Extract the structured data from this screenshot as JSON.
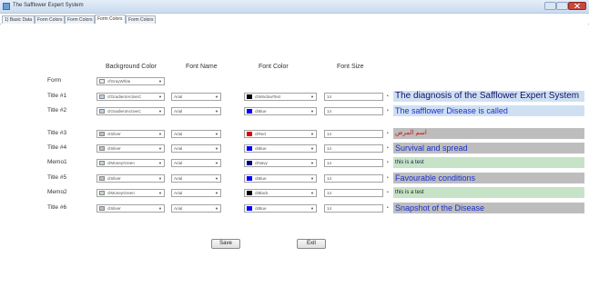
{
  "window": {
    "title": "The Safflower Expert System"
  },
  "tabs": [
    "1) Basic Data",
    "Form Colors",
    "Form Colors",
    "Form Colors",
    "Form Colors"
  ],
  "columns": {
    "background": "Background Color",
    "font_name": "Font Name",
    "font_color": "Font Color",
    "font_size": "Font Size"
  },
  "rows": [
    {
      "label": "Form",
      "bg_text": "cfGrayWhite",
      "bg_color": "#e8eef4",
      "font_name": "",
      "font_color_text": "",
      "font_color_swatch": "",
      "font_size": "",
      "preview": "",
      "preview_bg": "",
      "preview_color": "",
      "preview_size": "",
      "preview_bold": false
    },
    {
      "label": "Title #1",
      "bg_text": "cfGradientActiveC",
      "bg_color": "#b9d1ea",
      "font_name": "Arial",
      "font_color_text": "clWindowText",
      "font_color_swatch": "#000000",
      "font_size": "14",
      "preview": "The diagnosis of the Safflower Expert System",
      "preview_bg": "#cfe0f3",
      "preview_color": "#10106a",
      "preview_size": "10px",
      "preview_bold": false
    },
    {
      "label": "Title #2",
      "bg_text": "clGradientActiveC",
      "bg_color": "#b9d1ea",
      "font_name": "Arial",
      "font_color_text": "clBlue",
      "font_color_swatch": "#0000ff",
      "font_size": "14",
      "preview": "The safflower Disease is called",
      "preview_bg": "#cfe0f3",
      "preview_color": "#1a2fcf",
      "preview_size": "9px",
      "preview_bold": false
    },
    {
      "label": "Title #3",
      "bg_text": "clSilver",
      "bg_color": "#c0c0c0",
      "font_name": "Arial",
      "font_color_text": "clRed",
      "font_color_swatch": "#e00000",
      "font_size": "14",
      "preview": "اسم المرض",
      "preview_bg": "#bdbdbd",
      "preview_color": "#d01010",
      "preview_size": "7px",
      "preview_bold": false
    },
    {
      "label": "Title #4",
      "bg_text": "clSilver",
      "bg_color": "#c0c0c0",
      "font_name": "Arial",
      "font_color_text": "clBlue",
      "font_color_swatch": "#0000ff",
      "font_size": "14",
      "preview": "Survival and spread",
      "preview_bg": "#bdbdbd",
      "preview_color": "#1a2fcf",
      "preview_size": "9px",
      "preview_bold": false
    },
    {
      "label": "Memo1",
      "bg_text": "clMoneyGreen",
      "bg_color": "#c0dcc0",
      "font_name": "Arial",
      "font_color_text": "clNavy",
      "font_color_swatch": "#000080",
      "font_size": "14",
      "preview": "this is a test",
      "preview_bg": "#c7e3c7",
      "preview_color": "#102050",
      "preview_size": "6px",
      "preview_bold": false
    },
    {
      "label": "Title #5",
      "bg_text": "clSilver",
      "bg_color": "#c0c0c0",
      "font_name": "Arial",
      "font_color_text": "clBlue",
      "font_color_swatch": "#0000ff",
      "font_size": "14",
      "preview": "Favourable conditions",
      "preview_bg": "#bdbdbd",
      "preview_color": "#1a2fcf",
      "preview_size": "9px",
      "preview_bold": false
    },
    {
      "label": "Memo2",
      "bg_text": "clMoneyGreen",
      "bg_color": "#c0dcc0",
      "font_name": "Arial",
      "font_color_text": "clBlack",
      "font_color_swatch": "#000000",
      "font_size": "14",
      "preview": "this is a test",
      "preview_bg": "#c7e3c7",
      "preview_color": "#202020",
      "preview_size": "6px",
      "preview_bold": false
    },
    {
      "label": "Title #6",
      "bg_text": "clSilver",
      "bg_color": "#c0c0c0",
      "font_name": "Arial",
      "font_color_text": "clBlue",
      "font_color_swatch": "#0000ff",
      "font_size": "14",
      "preview": "Snapshot of the Disease",
      "preview_bg": "#bdbdbd",
      "preview_color": "#1a2fcf",
      "preview_size": "9px",
      "preview_bold": false
    }
  ],
  "buttons": {
    "save": "Save",
    "exit": "Exit"
  },
  "icons": {
    "app": "app-icon",
    "dropdown": "chevron-down-icon",
    "bullet": "bullet-icon"
  }
}
